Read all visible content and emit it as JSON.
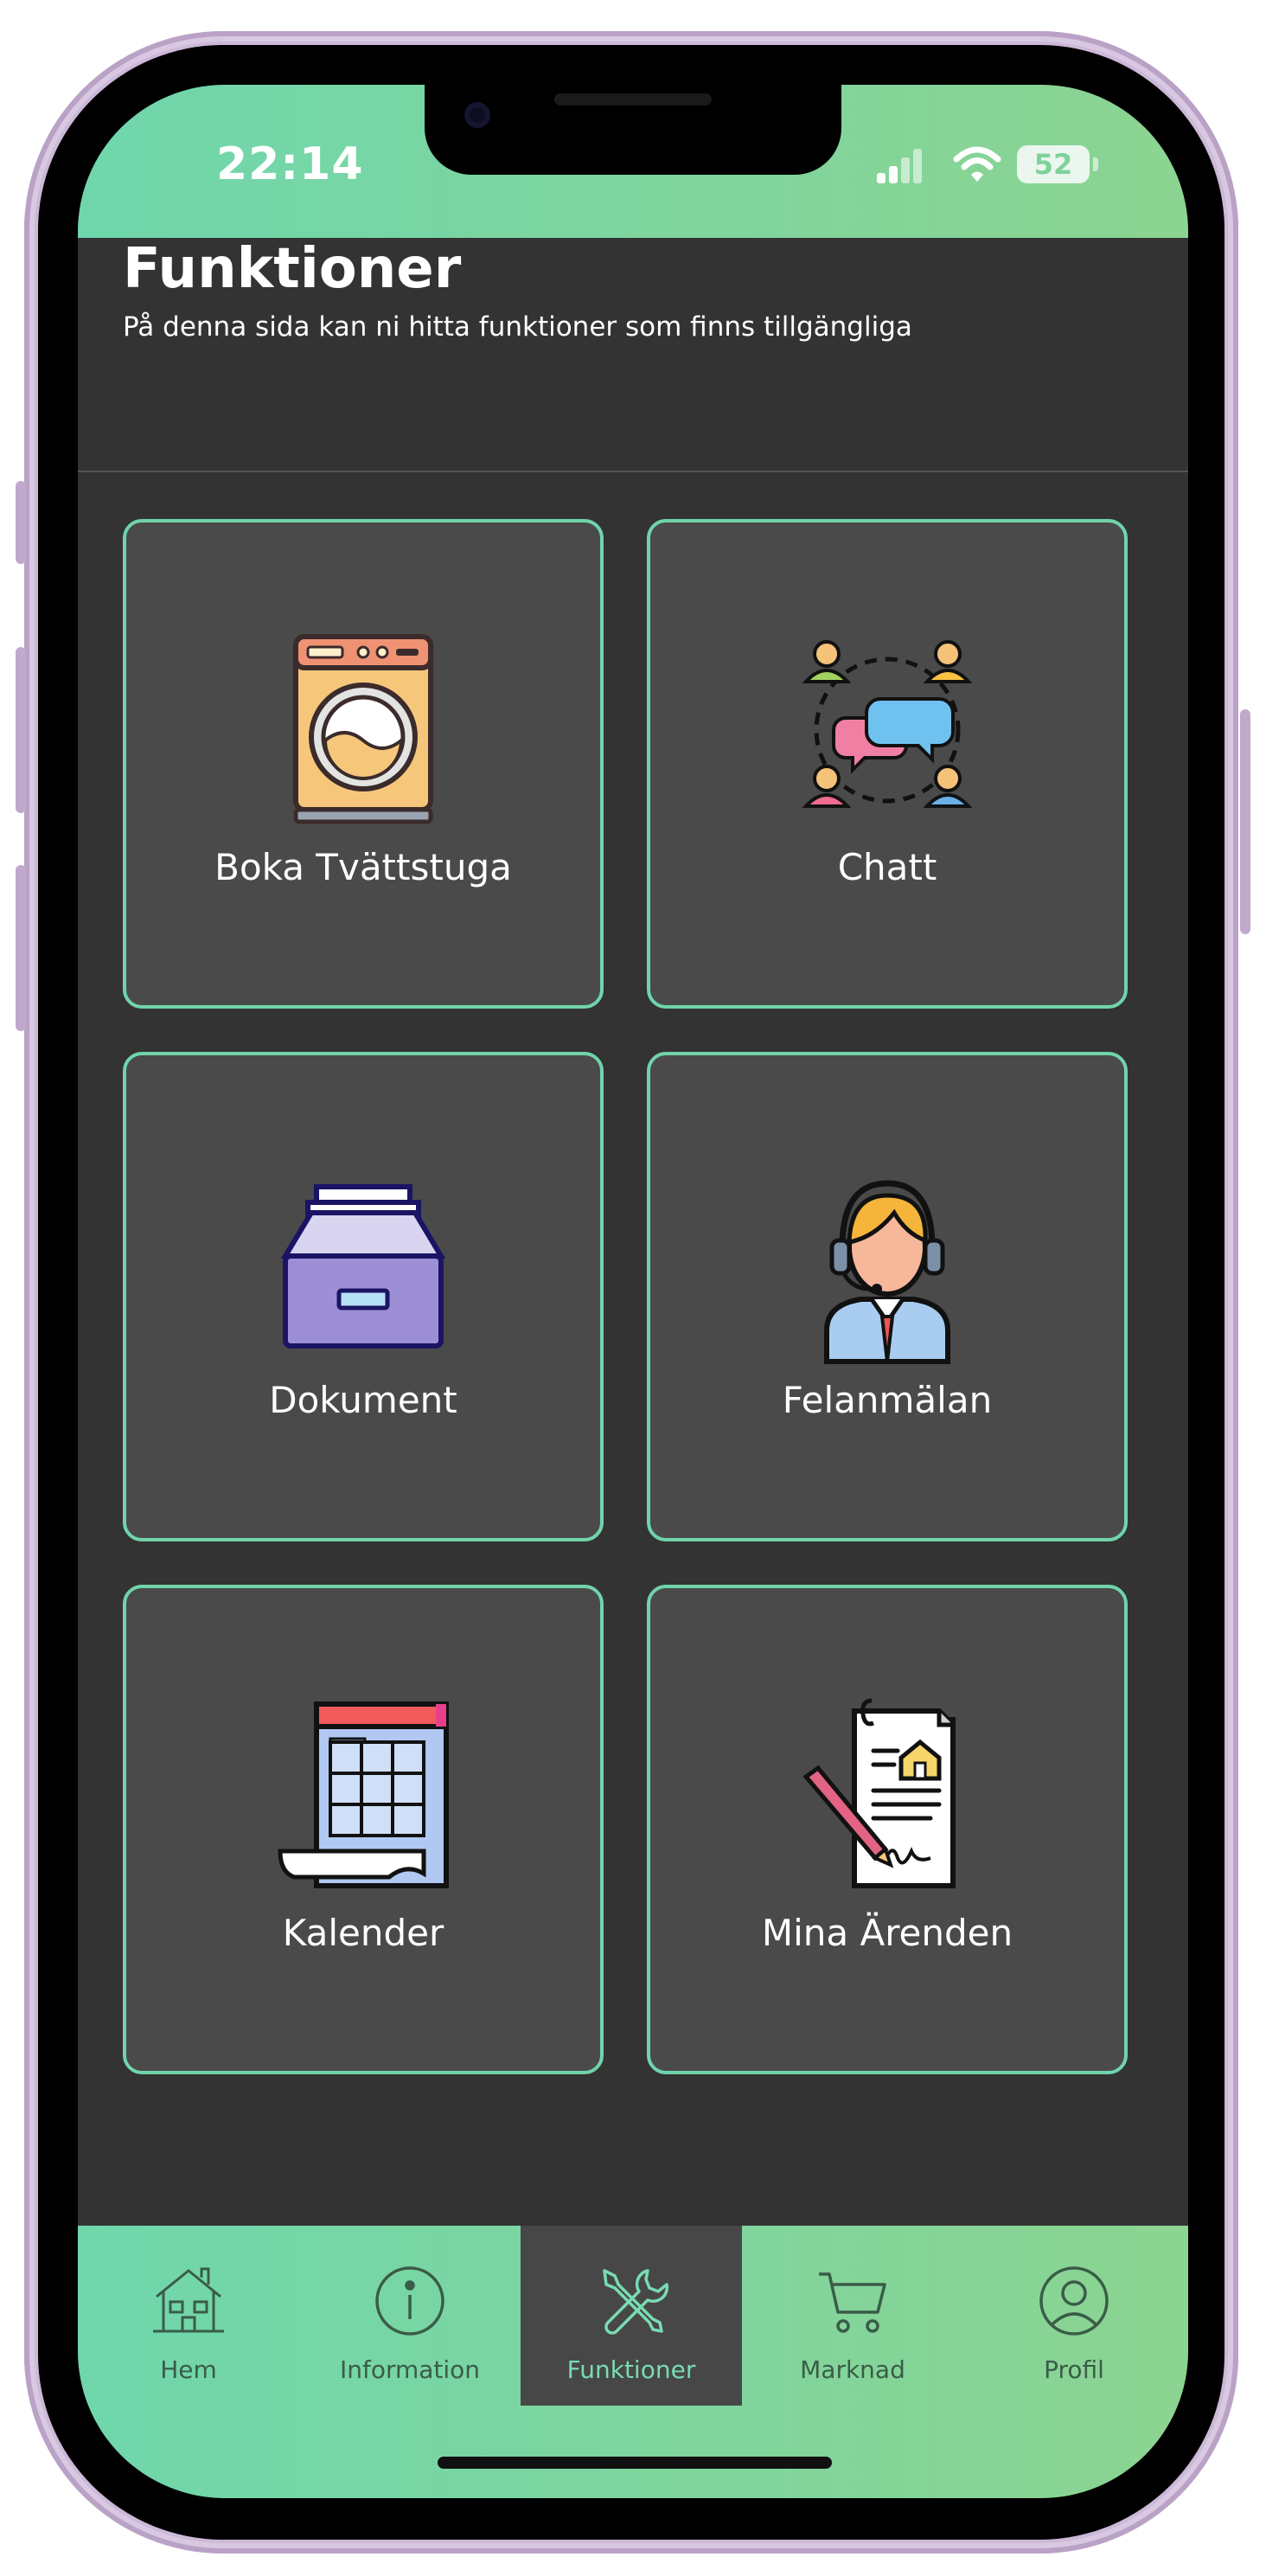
{
  "status_bar": {
    "time": "22:14",
    "battery": "52"
  },
  "header": {
    "title": "Funktioner",
    "subtitle": "På denna sida kan ni hitta funktioner som finns tillgängliga"
  },
  "tiles": [
    {
      "label": "Boka Tvättstuga",
      "icon": "washing-machine-icon"
    },
    {
      "label": "Chatt",
      "icon": "group-chat-icon"
    },
    {
      "label": "Dokument",
      "icon": "document-tray-icon"
    },
    {
      "label": "Felanmälan",
      "icon": "support-agent-icon"
    },
    {
      "label": "Kalender",
      "icon": "calendar-icon"
    },
    {
      "label": "Mina Ärenden",
      "icon": "contract-signing-icon"
    }
  ],
  "tab_bar": {
    "active": "Funktioner",
    "items": [
      {
        "label": "Hem",
        "icon": "house-icon"
      },
      {
        "label": "Information",
        "icon": "info-icon"
      },
      {
        "label": "Funktioner",
        "icon": "tools-icon"
      },
      {
        "label": "Marknad",
        "icon": "cart-icon"
      },
      {
        "label": "Profil",
        "icon": "user-icon"
      }
    ]
  },
  "colors": {
    "accent": "#70d4ab",
    "gradient_start": "#6fd6ac",
    "gradient_end": "#8cd491",
    "background": "#333333",
    "tile_background": "#4a4a4a"
  }
}
